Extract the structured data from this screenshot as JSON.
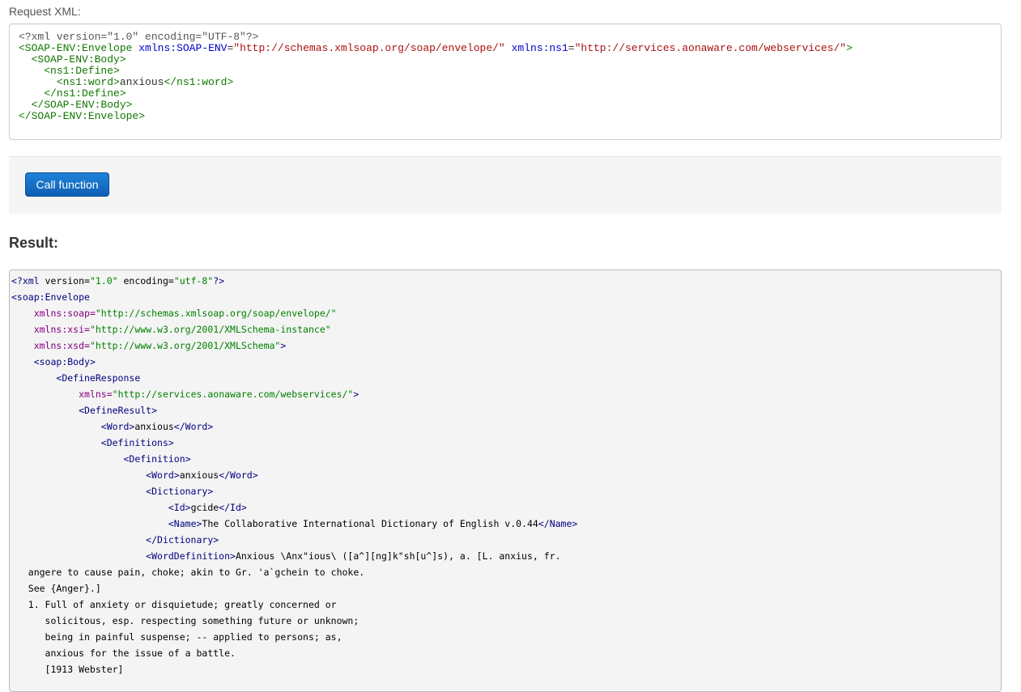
{
  "request": {
    "label": "Request XML:",
    "lines": [
      [
        [
          "xp",
          "<?xml version=\"1.0\" encoding=\"UTF-8\"?>"
        ]
      ],
      [
        [
          "xt",
          "<SOAP-ENV:Envelope"
        ],
        [
          "xx",
          " "
        ],
        [
          "xa",
          "xmlns:SOAP-ENV"
        ],
        [
          "xx",
          "="
        ],
        [
          "xv",
          "\"http://schemas.xmlsoap.org/soap/envelope/\""
        ],
        [
          "xx",
          " "
        ],
        [
          "xa",
          "xmlns:ns1"
        ],
        [
          "xx",
          "="
        ],
        [
          "xv",
          "\"http://services.aonaware.com/webservices/\""
        ],
        [
          "xt",
          ">"
        ]
      ],
      [
        [
          "xx",
          "  "
        ],
        [
          "xt",
          "<SOAP-ENV:Body>"
        ]
      ],
      [
        [
          "xx",
          "    "
        ],
        [
          "xt",
          "<ns1:Define>"
        ]
      ],
      [
        [
          "xx",
          "      "
        ],
        [
          "xt",
          "<ns1:word>"
        ],
        [
          "xx",
          "anxious"
        ],
        [
          "xt",
          "</ns1:word>"
        ]
      ],
      [
        [
          "xx",
          "    "
        ],
        [
          "xt",
          "</ns1:Define>"
        ]
      ],
      [
        [
          "xx",
          "  "
        ],
        [
          "xt",
          "</SOAP-ENV:Body>"
        ]
      ],
      [
        [
          "xt",
          "</SOAP-ENV:Envelope>"
        ]
      ]
    ]
  },
  "actions": {
    "call_label": "Call function"
  },
  "result": {
    "heading": "Result:",
    "lines": [
      [
        [
          "rt",
          "<?xml "
        ],
        [
          "rx",
          "version="
        ],
        [
          "rv",
          "\"1.0\""
        ],
        [
          "rx",
          " encoding="
        ],
        [
          "rv",
          "\"utf-8\""
        ],
        [
          "rt",
          "?>"
        ]
      ],
      [
        [
          "rt",
          "<soap:Envelope"
        ]
      ],
      [
        [
          "rx",
          "    "
        ],
        [
          "ra",
          "xmlns:soap="
        ],
        [
          "rv",
          "\"http://schemas.xmlsoap.org/soap/envelope/\""
        ]
      ],
      [
        [
          "rx",
          "    "
        ],
        [
          "ra",
          "xmlns:xsi="
        ],
        [
          "rv",
          "\"http://www.w3.org/2001/XMLSchema-instance\""
        ]
      ],
      [
        [
          "rx",
          "    "
        ],
        [
          "ra",
          "xmlns:xsd="
        ],
        [
          "rv",
          "\"http://www.w3.org/2001/XMLSchema\""
        ],
        [
          "rt",
          ">"
        ]
      ],
      [
        [
          "rx",
          "    "
        ],
        [
          "rt",
          "<soap:Body>"
        ]
      ],
      [
        [
          "rx",
          "        "
        ],
        [
          "rt",
          "<DefineResponse"
        ]
      ],
      [
        [
          "rx",
          "            "
        ],
        [
          "ra",
          "xmlns="
        ],
        [
          "rv",
          "\"http://services.aonaware.com/webservices/\""
        ],
        [
          "rt",
          ">"
        ]
      ],
      [
        [
          "rx",
          "            "
        ],
        [
          "rt",
          "<DefineResult>"
        ]
      ],
      [
        [
          "rx",
          "                "
        ],
        [
          "rt",
          "<Word>"
        ],
        [
          "rx",
          "anxious"
        ],
        [
          "rt",
          "</Word>"
        ]
      ],
      [
        [
          "rx",
          "                "
        ],
        [
          "rt",
          "<Definitions>"
        ]
      ],
      [
        [
          "rx",
          "                    "
        ],
        [
          "rt",
          "<Definition>"
        ]
      ],
      [
        [
          "rx",
          "                        "
        ],
        [
          "rt",
          "<Word>"
        ],
        [
          "rx",
          "anxious"
        ],
        [
          "rt",
          "</Word>"
        ]
      ],
      [
        [
          "rx",
          "                        "
        ],
        [
          "rt",
          "<Dictionary>"
        ]
      ],
      [
        [
          "rx",
          "                            "
        ],
        [
          "rt",
          "<Id>"
        ],
        [
          "rx",
          "gcide"
        ],
        [
          "rt",
          "</Id>"
        ]
      ],
      [
        [
          "rx",
          "                            "
        ],
        [
          "rt",
          "<Name>"
        ],
        [
          "rx",
          "The Collaborative International Dictionary of English v.0.44"
        ],
        [
          "rt",
          "</Name>"
        ]
      ],
      [
        [
          "rx",
          "                        "
        ],
        [
          "rt",
          "</Dictionary>"
        ]
      ],
      [
        [
          "rx",
          "                        "
        ],
        [
          "rt",
          "<WordDefinition>"
        ],
        [
          "rx",
          "Anxious \\Anx\"ious\\ ([a^][ng]k\"sh[u^]s), a. [L. anxius, fr."
        ]
      ],
      [
        [
          "rx",
          "   angere to cause pain, choke; akin to Gr. 'a`gchein to choke."
        ]
      ],
      [
        [
          "rx",
          "   See {Anger}.]"
        ]
      ],
      [
        [
          "rx",
          "   1. Full of anxiety or disquietude; greatly concerned or"
        ]
      ],
      [
        [
          "rx",
          "      solicitous, esp. respecting something future or unknown;"
        ]
      ],
      [
        [
          "rx",
          "      being in painful suspense; -- applied to persons; as,"
        ]
      ],
      [
        [
          "rx",
          "      anxious for the issue of a battle."
        ]
      ],
      [
        [
          "rx",
          "      [1913 Webster]"
        ]
      ]
    ]
  }
}
